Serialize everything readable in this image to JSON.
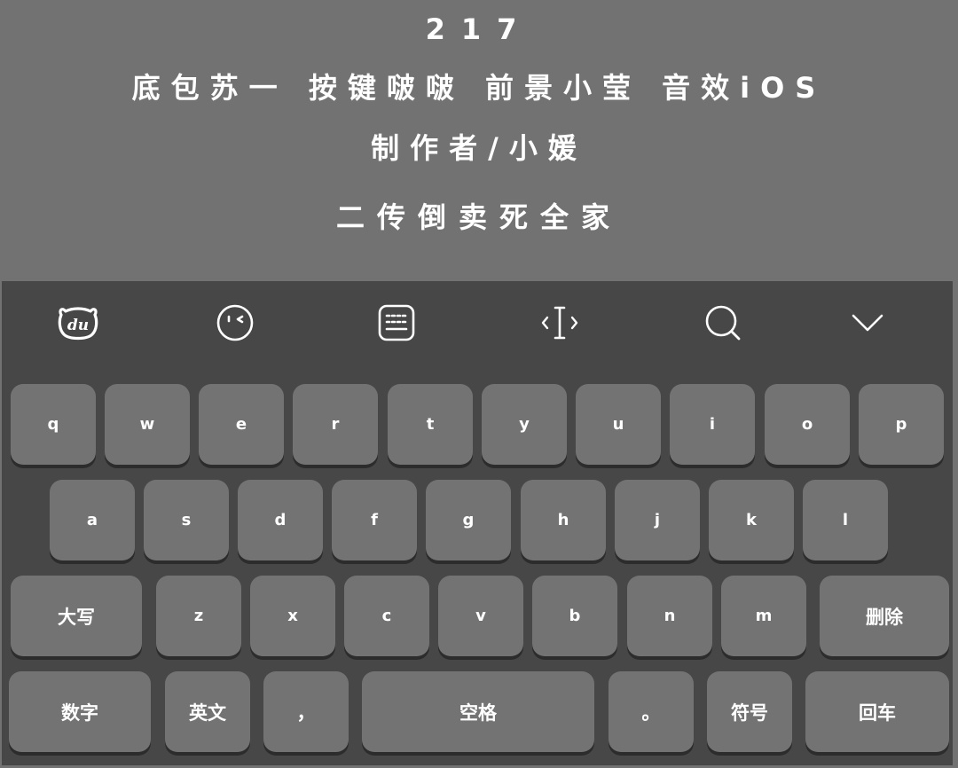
{
  "overlay_text": {
    "line1": "217",
    "line2": "底包苏一 按键啵啵 前景小莹 音效iOS",
    "line3": "制作者/小媛",
    "line4": "二传倒卖死全家"
  },
  "toolbar": {
    "icons": [
      "du-bear-logo-icon",
      "emoji-face-icon",
      "keyboard-layout-icon",
      "text-cursor-icon",
      "search-icon",
      "collapse-chevron-icon"
    ]
  },
  "keys": {
    "row1": [
      "q",
      "w",
      "e",
      "r",
      "t",
      "y",
      "u",
      "i",
      "o",
      "p"
    ],
    "row2": [
      "a",
      "s",
      "d",
      "f",
      "g",
      "h",
      "j",
      "k",
      "l"
    ],
    "row3": {
      "shift": "大写",
      "letters": [
        "z",
        "x",
        "c",
        "v",
        "b",
        "n",
        "m"
      ],
      "delete": "删除"
    },
    "row4": {
      "numbers": "数字",
      "english": "英文",
      "comma": "，",
      "space": "空格",
      "period": "。",
      "symbols": "符号",
      "enter": "回车"
    }
  },
  "colors": {
    "page_background": "#727272",
    "keyboard_background": "#474747",
    "key_background": "#737373",
    "key_shadow": "#2c2c2c",
    "text": "#ffffff"
  }
}
